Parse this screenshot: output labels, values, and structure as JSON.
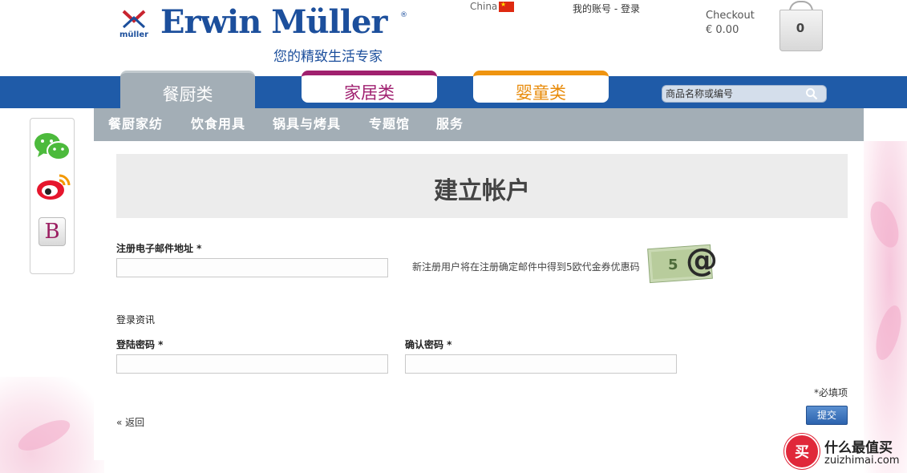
{
  "header": {
    "brand": "Erwin Müller",
    "brand_mark": "müller",
    "reg_mark": "®",
    "tagline": "您的精致生活专家",
    "country": "China",
    "account_link": "我的账号 - 登录",
    "checkout_label": "Checkout",
    "checkout_total": "€ 0.00",
    "cart_count": "0"
  },
  "tabs": [
    {
      "label": "餐厨类",
      "color": "#a3aeb6"
    },
    {
      "label": "家居类",
      "color": "#a0206e"
    },
    {
      "label": "婴童类",
      "color": "#ef9410"
    }
  ],
  "search": {
    "placeholder": "商品名称或编号"
  },
  "subnav": [
    "餐厨家纺",
    "饮食用具",
    "锅具与烤具",
    "专题馆",
    "服务"
  ],
  "social": {
    "b_icon_letter": "B"
  },
  "form": {
    "title": "建立帐户",
    "email_label": "注册电子邮件地址 *",
    "email_value": "",
    "voucher_note": "新注册用户将在注册确定邮件中得到5欧代金券优惠码",
    "voucher_glyph": "@",
    "voucher_amount": "5",
    "login_section": "登录资讯",
    "password_label": "登陆密码 *",
    "password_value": "",
    "confirm_label": "确认密码 *",
    "confirm_value": "",
    "required_note": "*必填项",
    "back_link": "« 返回",
    "submit_label": "提交"
  },
  "watermark": {
    "mark": "买",
    "line1": "什么最值买",
    "line2": "zuizhimai.com"
  },
  "colors": {
    "brand_blue": "#1c4f9c",
    "band_blue": "#1f5ba8",
    "nav_gray": "#a3aeb6"
  }
}
